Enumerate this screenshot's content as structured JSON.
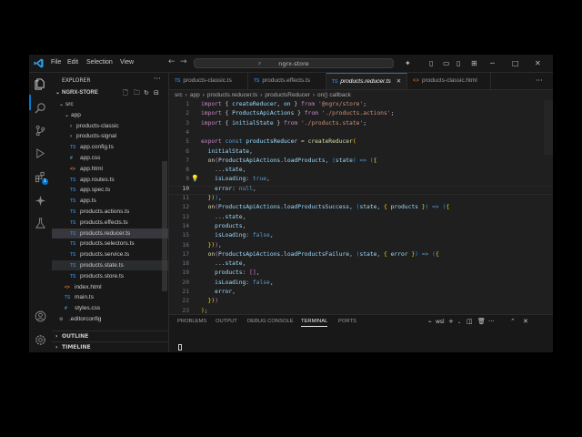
{
  "menu": [
    "File",
    "Edit",
    "Selection",
    "View"
  ],
  "command_center": "ngrx-store",
  "sidebar": {
    "title": "EXPLORER",
    "more": "···",
    "project": "NGRX-STORE",
    "tree": [
      {
        "label": "src",
        "kind": "folder",
        "open": true,
        "indent": 1
      },
      {
        "label": "app",
        "kind": "folder",
        "open": true,
        "indent": 2
      },
      {
        "label": "products-classic",
        "kind": "folder",
        "open": false,
        "indent": 3
      },
      {
        "label": "products-signal",
        "kind": "folder",
        "open": false,
        "indent": 3
      },
      {
        "label": "app.config.ts",
        "kind": "ts",
        "indent": 3
      },
      {
        "label": "app.css",
        "kind": "css",
        "indent": 3
      },
      {
        "label": "app.html",
        "kind": "html",
        "indent": 3
      },
      {
        "label": "app.routes.ts",
        "kind": "ts",
        "indent": 3
      },
      {
        "label": "app.spec.ts",
        "kind": "ts",
        "indent": 3
      },
      {
        "label": "app.ts",
        "kind": "ts",
        "indent": 3
      },
      {
        "label": "products.actions.ts",
        "kind": "ts",
        "indent": 3
      },
      {
        "label": "products.effects.ts",
        "kind": "ts",
        "indent": 3
      },
      {
        "label": "products.reducer.ts",
        "kind": "ts",
        "indent": 3,
        "selected": true
      },
      {
        "label": "products.selectors.ts",
        "kind": "ts",
        "indent": 3
      },
      {
        "label": "products.service.ts",
        "kind": "ts",
        "indent": 3
      },
      {
        "label": "products.state.ts",
        "kind": "ts",
        "indent": 3,
        "hover": true
      },
      {
        "label": "products.store.ts",
        "kind": "ts",
        "indent": 3
      },
      {
        "label": "index.html",
        "kind": "html",
        "indent": 2
      },
      {
        "label": "main.ts",
        "kind": "ts",
        "indent": 2
      },
      {
        "label": "styles.css",
        "kind": "css",
        "indent": 2
      },
      {
        "label": ".editorconfig",
        "kind": "cfg",
        "indent": 1
      }
    ],
    "outline": "OUTLINE",
    "timeline": "TIMELINE"
  },
  "activity_icons": [
    "explorer-icon",
    "search-icon",
    "source-control-icon",
    "run-debug-icon",
    "extensions-icon",
    "copilot-icon",
    "testing-icon",
    "account-icon",
    "settings-icon"
  ],
  "extensions_badge": "1",
  "tabs": [
    {
      "label": "products-classic.ts",
      "kind": "ts",
      "active": false
    },
    {
      "label": "products.effects.ts",
      "kind": "ts",
      "active": false
    },
    {
      "label": "products.reducer.ts",
      "kind": "ts",
      "active": true
    },
    {
      "label": "products-classic.html",
      "kind": "html",
      "active": false
    }
  ],
  "file_icon_labels": {
    "ts": "TS",
    "css": "#",
    "html": "<>",
    "cfg": "⚙"
  },
  "breadcrumb": [
    "src",
    "app",
    "products.reducer.ts",
    "productsReducer",
    "on() callback"
  ],
  "editor": {
    "current_line": 10,
    "lightbulb_line": 9,
    "lines": [
      [
        [
          "import",
          "kw"
        ],
        [
          " { ",
          "pl"
        ],
        [
          "createReducer",
          "var"
        ],
        [
          ", ",
          "pl"
        ],
        [
          "on",
          "var"
        ],
        [
          " } ",
          "pl"
        ],
        [
          "from",
          "kw"
        ],
        [
          " ",
          "pl"
        ],
        [
          "'@ngrx/store'",
          "str"
        ],
        [
          ";",
          "pl"
        ]
      ],
      [
        [
          "import",
          "kw"
        ],
        [
          " { ",
          "pl"
        ],
        [
          "ProductsApiActions",
          "var"
        ],
        [
          " } ",
          "pl"
        ],
        [
          "from",
          "kw"
        ],
        [
          " ",
          "pl"
        ],
        [
          "'./products.actions'",
          "str"
        ],
        [
          ";",
          "pl"
        ]
      ],
      [
        [
          "import",
          "kw"
        ],
        [
          " { ",
          "pl"
        ],
        [
          "initialState",
          "var"
        ],
        [
          " } ",
          "pl"
        ],
        [
          "from",
          "kw"
        ],
        [
          " ",
          "pl"
        ],
        [
          "'./products.state'",
          "str"
        ],
        [
          ";",
          "pl"
        ]
      ],
      [],
      [
        [
          "export",
          "kw"
        ],
        [
          " ",
          "pl"
        ],
        [
          "const",
          "kb"
        ],
        [
          " ",
          "pl"
        ],
        [
          "productsReducer",
          "var"
        ],
        [
          " = ",
          "pl"
        ],
        [
          "createReducer",
          "fn"
        ],
        [
          "(",
          "br1"
        ]
      ],
      [
        [
          "  initialState",
          "var"
        ],
        [
          ",",
          "pl"
        ]
      ],
      [
        [
          "  ",
          "pl"
        ],
        [
          "on",
          "fn"
        ],
        [
          "(",
          "br2"
        ],
        [
          "ProductsApiActions",
          "var"
        ],
        [
          ".",
          "pl"
        ],
        [
          "loadProducts",
          "var"
        ],
        [
          ", ",
          "pl"
        ],
        [
          "(",
          "br3"
        ],
        [
          "state",
          "var"
        ],
        [
          ")",
          "br3"
        ],
        [
          " ",
          "pl"
        ],
        [
          "=>",
          "kb"
        ],
        [
          " ",
          "pl"
        ],
        [
          "(",
          "br3"
        ],
        [
          "{",
          "br1"
        ]
      ],
      [
        [
          "    ...",
          "pl"
        ],
        [
          "state",
          "var"
        ],
        [
          ",",
          "pl"
        ]
      ],
      [
        [
          "    isLoading",
          "var"
        ],
        [
          ": ",
          "pl"
        ],
        [
          "true",
          "kb"
        ],
        [
          ",",
          "pl"
        ]
      ],
      [
        [
          "    error",
          "var"
        ],
        [
          ": ",
          "pl"
        ],
        [
          "null",
          "kb"
        ],
        [
          ",",
          "pl"
        ]
      ],
      [
        [
          "  ",
          "pl"
        ],
        [
          "})",
          "br1"
        ],
        [
          ")",
          "br3"
        ],
        [
          ",",
          "pl"
        ]
      ],
      [
        [
          "  ",
          "pl"
        ],
        [
          "on",
          "fn"
        ],
        [
          "(",
          "br2"
        ],
        [
          "ProductsApiActions",
          "var"
        ],
        [
          ".",
          "pl"
        ],
        [
          "loadProductsSuccess",
          "var"
        ],
        [
          ", ",
          "pl"
        ],
        [
          "(",
          "br3"
        ],
        [
          "state",
          "var"
        ],
        [
          ", ",
          "pl"
        ],
        [
          "{ ",
          "br1"
        ],
        [
          "products",
          "var"
        ],
        [
          " }",
          "br1"
        ],
        [
          ")",
          "br3"
        ],
        [
          " ",
          "pl"
        ],
        [
          "=>",
          "kb"
        ],
        [
          " ",
          "pl"
        ],
        [
          "(",
          "br3"
        ],
        [
          "{",
          "br1"
        ]
      ],
      [
        [
          "    ...",
          "pl"
        ],
        [
          "state",
          "var"
        ],
        [
          ",",
          "pl"
        ]
      ],
      [
        [
          "    products",
          "var"
        ],
        [
          ",",
          "pl"
        ]
      ],
      [
        [
          "    isLoading",
          "var"
        ],
        [
          ": ",
          "pl"
        ],
        [
          "false",
          "kb"
        ],
        [
          ",",
          "pl"
        ]
      ],
      [
        [
          "  ",
          "pl"
        ],
        [
          "})",
          "br1"
        ],
        [
          ")",
          "br2"
        ],
        [
          ",",
          "pl"
        ]
      ],
      [
        [
          "  ",
          "pl"
        ],
        [
          "on",
          "fn"
        ],
        [
          "(",
          "br2"
        ],
        [
          "ProductsApiActions",
          "var"
        ],
        [
          ".",
          "pl"
        ],
        [
          "loadProductsFailure",
          "var"
        ],
        [
          ", ",
          "pl"
        ],
        [
          "(",
          "br3"
        ],
        [
          "state",
          "var"
        ],
        [
          ", ",
          "pl"
        ],
        [
          "{ ",
          "br1"
        ],
        [
          "error",
          "var"
        ],
        [
          " }",
          "br1"
        ],
        [
          ")",
          "br3"
        ],
        [
          " ",
          "pl"
        ],
        [
          "=>",
          "kb"
        ],
        [
          " ",
          "pl"
        ],
        [
          "(",
          "br3"
        ],
        [
          "{",
          "br1"
        ]
      ],
      [
        [
          "    ...",
          "pl"
        ],
        [
          "state",
          "var"
        ],
        [
          ",",
          "pl"
        ]
      ],
      [
        [
          "    products",
          "var"
        ],
        [
          ": ",
          "pl"
        ],
        [
          "[]",
          "br2"
        ],
        [
          ",",
          "pl"
        ]
      ],
      [
        [
          "    isLoading",
          "var"
        ],
        [
          ": ",
          "pl"
        ],
        [
          "false",
          "kb"
        ],
        [
          ",",
          "pl"
        ]
      ],
      [
        [
          "    error",
          "var"
        ],
        [
          ",",
          "pl"
        ]
      ],
      [
        [
          "  ",
          "pl"
        ],
        [
          "})",
          "br1"
        ],
        [
          ")",
          "br2"
        ]
      ],
      [
        [
          ")",
          "br1"
        ],
        [
          ";",
          "pl"
        ]
      ]
    ]
  },
  "panel": {
    "tabs": [
      "PROBLEMS",
      "OUTPUT",
      "DEBUG CONSOLE",
      "TERMINAL",
      "PORTS"
    ],
    "active_tab": "TERMINAL",
    "shell": "wsl"
  },
  "colors": {
    "accent": "#0078d4",
    "ts_icon": "#3178c6",
    "html_icon": "#e37933",
    "css_icon": "#519aba"
  }
}
